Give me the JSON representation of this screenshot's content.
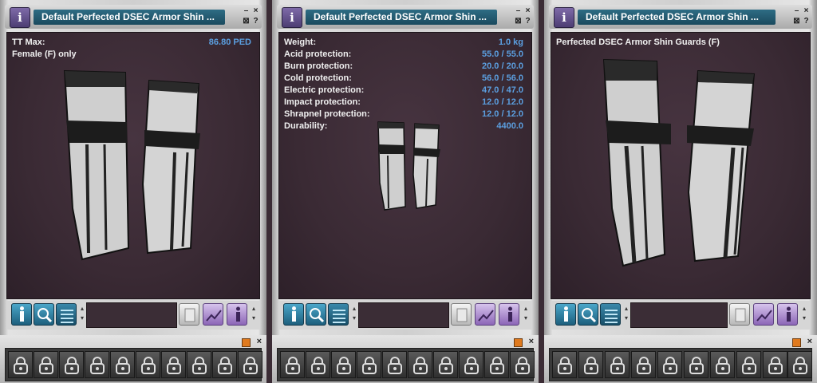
{
  "panels": [
    {
      "title": "Default Perfected DSEC Armor Shin ...",
      "lines": [
        {
          "key": "TT Max:",
          "value": "86.80 PED"
        },
        {
          "key": "Female (F) only",
          "value": ""
        }
      ]
    },
    {
      "title": "Default Perfected DSEC Armor Shin ...",
      "lines": [
        {
          "key": "Weight:",
          "value": "1.0 kg"
        },
        {
          "key": "Acid protection:",
          "value": "55.0 / 55.0"
        },
        {
          "key": "Burn protection:",
          "value": "20.0 / 20.0"
        },
        {
          "key": "Cold protection:",
          "value": "56.0 / 56.0"
        },
        {
          "key": "Electric protection:",
          "value": "47.0 / 47.0"
        },
        {
          "key": "Impact protection:",
          "value": "12.0 / 12.0"
        },
        {
          "key": "Shrapnel protection:",
          "value": "12.0 / 12.0"
        },
        {
          "key": "Durability:",
          "value": "4400.0"
        }
      ]
    },
    {
      "title": "Default Perfected DSEC Armor Shin ...",
      "lines": [
        {
          "key": "Perfected DSEC Armor Shin Guards (F)",
          "value": ""
        }
      ]
    }
  ],
  "window_controls": {
    "minimize": "–",
    "close": "×",
    "help": "?",
    "pin": "⊠"
  },
  "info_glyph": "i",
  "trade_bar": {
    "slot_count": 10,
    "slot_icon": "lock-icon",
    "close": "×"
  },
  "colors": {
    "title_bg": "#1f5870",
    "value_text": "#5b9fe0",
    "viewport_bg": "#3a2a34",
    "accent_orange": "#e07a1e"
  }
}
